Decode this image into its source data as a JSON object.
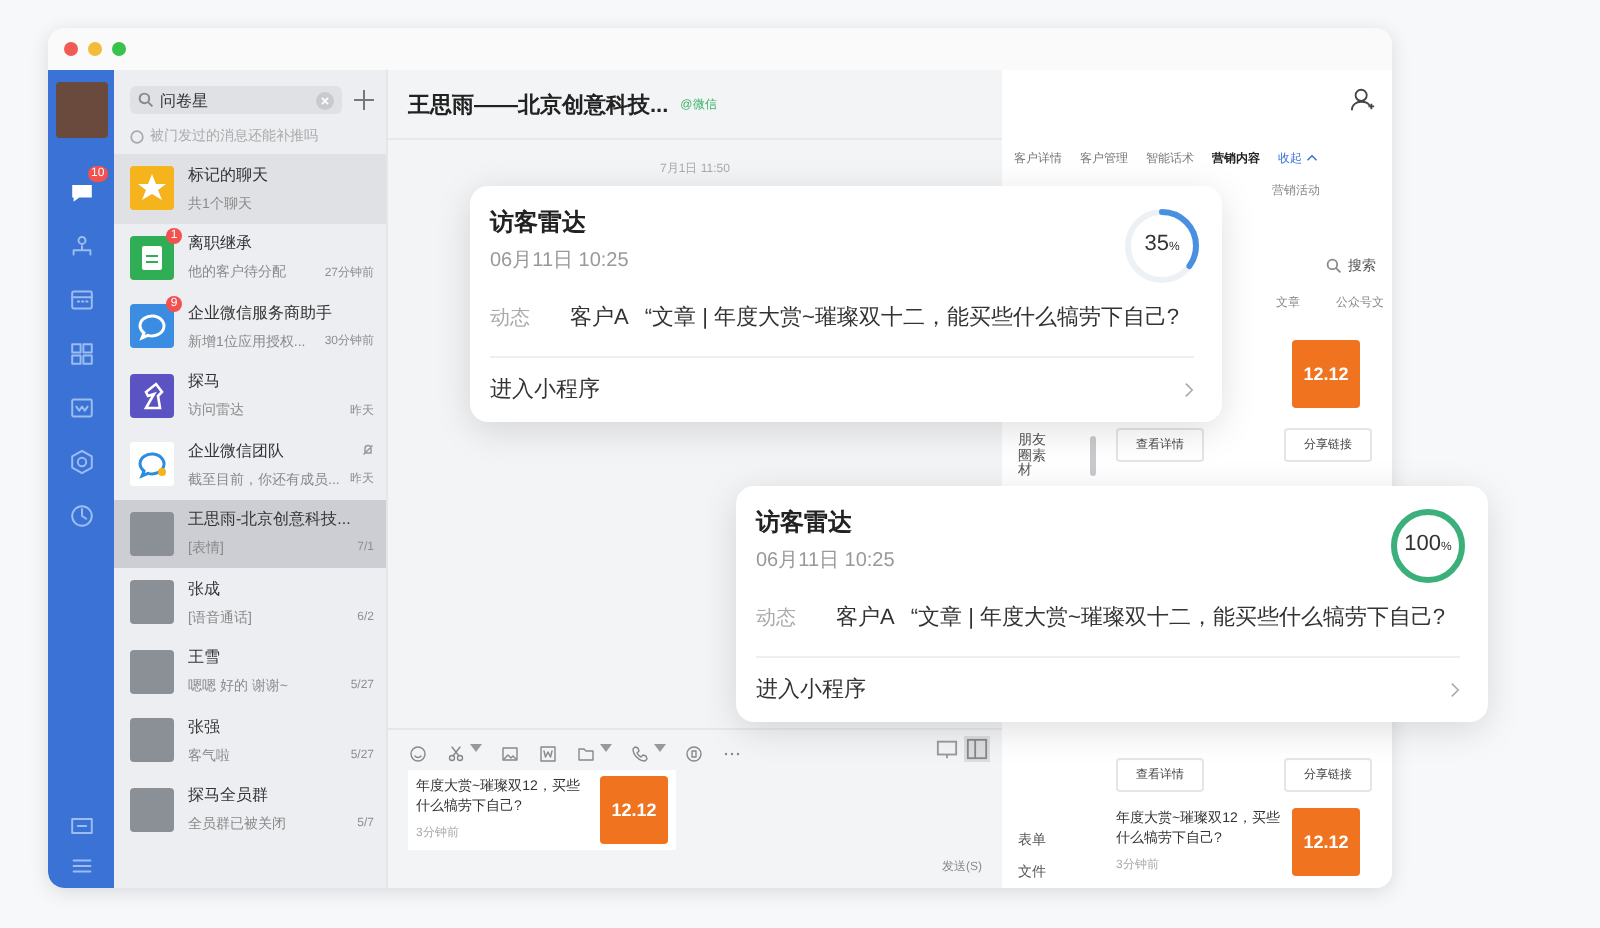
{
  "rail": {
    "items": [
      {
        "kind": "chat",
        "badge": "10",
        "selected": true
      },
      {
        "kind": "contacts",
        "selected": false
      },
      {
        "kind": "calendar",
        "selected": false
      },
      {
        "kind": "apps",
        "selected": false
      },
      {
        "kind": "doc",
        "selected": false
      },
      {
        "kind": "gear",
        "selected": false
      },
      {
        "kind": "cloud",
        "selected": false
      }
    ],
    "bottom": [
      {
        "kind": "mail"
      },
      {
        "kind": "menu"
      }
    ]
  },
  "chat_list": {
    "search": {
      "value": "问卷星"
    },
    "hint": "被门发过的消息还能补推吗",
    "items": [
      {
        "kind": "star",
        "name": "标记的聊天",
        "preview": "共1个聊天",
        "selected": false,
        "highlighted": true
      },
      {
        "kind": "doc",
        "name": "离职继承",
        "preview": "他的客户待分配",
        "time": "27分钟前",
        "badge": "1",
        "selected": false
      },
      {
        "kind": "bubble",
        "name": "企业微信服务商助手",
        "preview": "新增1位应用授权...",
        "time": "30分钟前",
        "badge": "9",
        "selected": false
      },
      {
        "kind": "horse",
        "name": "探马",
        "preview": "访问雷达",
        "time": "昨天",
        "selected": false
      },
      {
        "kind": "team",
        "name": "企业微信团队",
        "preview": "截至目前，你还有成员...",
        "time": "昨天",
        "muted": true,
        "selected": false
      },
      {
        "kind": "photo",
        "name": "王思雨-北京创意科技...",
        "preview": "[表情]",
        "time": "7/1",
        "selected": true
      },
      {
        "kind": "photo",
        "name": "张成",
        "preview": "[语音通话]",
        "time": "6/2",
        "selected": false
      },
      {
        "kind": "photo",
        "name": "王雪",
        "preview": "嗯嗯 好的 谢谢~",
        "time": "5/27",
        "selected": false
      },
      {
        "kind": "photo",
        "name": "张强",
        "preview": "客气啦",
        "time": "5/27",
        "selected": false
      },
      {
        "kind": "photo",
        "name": "探马全员群",
        "preview": "全员群已被关闭",
        "time": "5/7",
        "selected": false
      }
    ]
  },
  "chat": {
    "title": "王思雨——北京创意科技...",
    "tag": "@微信",
    "timestamp": "7月1日 11:50",
    "toolbar": [
      {
        "kind": "emoji",
        "caret": false
      },
      {
        "kind": "scissors",
        "caret": true
      },
      {
        "kind": "image",
        "caret": false
      },
      {
        "kind": "word",
        "caret": false
      },
      {
        "kind": "folder",
        "caret": true
      },
      {
        "kind": "phone",
        "caret": true
      },
      {
        "kind": "shield",
        "caret": false
      },
      {
        "kind": "more",
        "caret": false
      }
    ],
    "draft": {
      "text": "年度大赏~璀璨双12，买些什么犒劳下自己?",
      "time": "3分钟前",
      "image": "12.12"
    },
    "send": "发送(S)"
  },
  "side_panel": {
    "tabs": [
      {
        "label": "客户详情",
        "selected": false
      },
      {
        "label": "客户管理",
        "selected": false
      },
      {
        "label": "智能话术",
        "selected": false
      },
      {
        "label": "营销内容",
        "selected": true
      }
    ],
    "collapse": "收起",
    "subtabs": [
      "营销活动"
    ],
    "search": "搜索",
    "categories": [
      "文章",
      "公众号文"
    ],
    "materials": [
      "朋友圈素材",
      "表单",
      "文件"
    ],
    "post_top": {
      "image": "12.12",
      "buttons": [
        "查看详情",
        "分享链接"
      ]
    },
    "post_mid": {
      "buttons": [
        "查看详情",
        "分享链接"
      ]
    },
    "post_bottom": {
      "text": "年度大赏~璀璨双12，买些什么犒劳下自己?",
      "time": "3分钟前",
      "image": "12.12"
    }
  },
  "radar_cards": [
    {
      "title": "访客雷达",
      "time": "06月11日 10:25",
      "value": "35",
      "unit": "%",
      "level": 0.35,
      "label": "动态",
      "customer": "客户A",
      "content": "“文章 | 年度大赏~璀璨双十二，能买些什么犒劳下自己?",
      "link": "进入小程序"
    },
    {
      "title": "访客雷达",
      "time": "06月11日 10:25",
      "value": "100",
      "unit": "%",
      "level": 1,
      "label": "动态",
      "customer": "客户A",
      "content": "“文章 | 年度大赏~璀璨双十二，能买些什么犒劳下自己?",
      "link": "进入小程序"
    }
  ]
}
